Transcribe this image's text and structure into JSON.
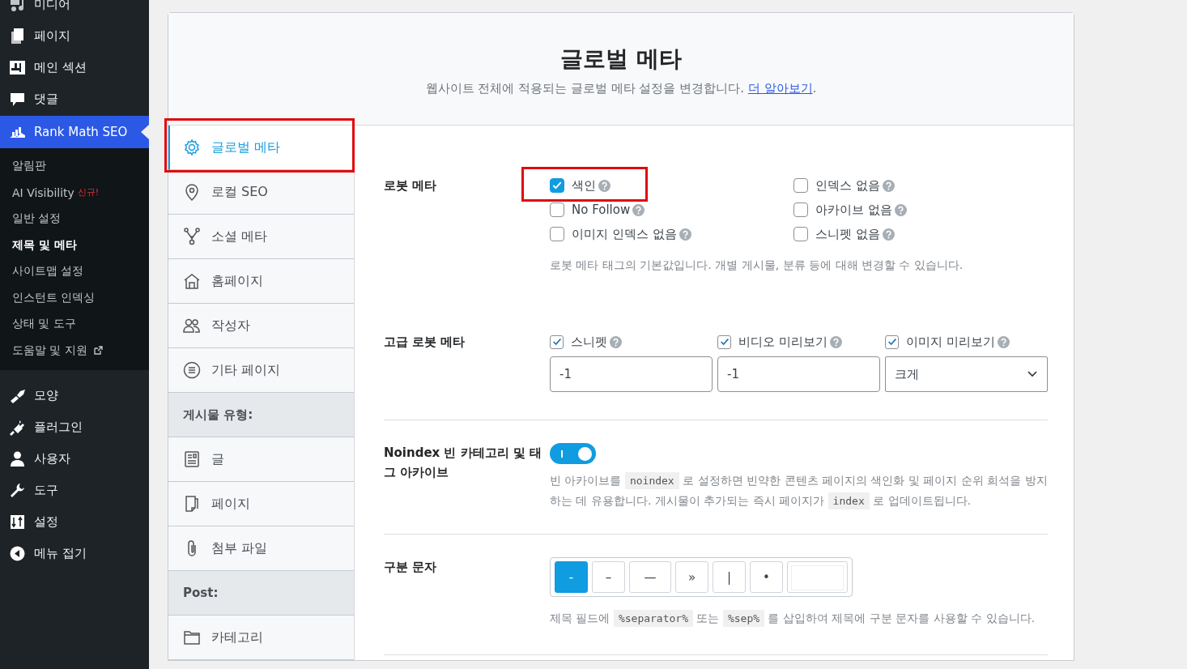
{
  "admin_menu": {
    "items_before": [
      {
        "label": "미디어",
        "selected": false
      },
      {
        "label": "페이지",
        "selected": false
      },
      {
        "label": "메인 섹션",
        "selected": false
      },
      {
        "label": "댓글",
        "selected": false
      }
    ],
    "active": {
      "label": "Rank Math SEO",
      "selected": true,
      "submenu": [
        {
          "label": "알림판",
          "selected": false
        },
        {
          "label": "AI Visibility",
          "badge": "신규!",
          "selected": false
        },
        {
          "label": "일반 설정",
          "selected": false
        },
        {
          "label": "제목 및 메타",
          "selected": true
        },
        {
          "label": "사이트맵 설정",
          "selected": false
        },
        {
          "label": "인스턴트 인덱싱",
          "selected": false
        },
        {
          "label": "상태 및 도구",
          "selected": false
        },
        {
          "label": "도움말 및 지원",
          "external": true,
          "selected": false
        }
      ]
    },
    "items_after": [
      {
        "label": "모양",
        "selected": false
      },
      {
        "label": "플러그인",
        "selected": false
      },
      {
        "label": "사용자",
        "selected": false
      },
      {
        "label": "도구",
        "selected": false
      },
      {
        "label": "설정",
        "selected": false
      },
      {
        "label": "메뉴 접기",
        "selected": false
      }
    ]
  },
  "header": {
    "title": "글로벌 메타",
    "description": "웹사이트 전체에 적용되는 글로벌 메타 설정을 변경합니다. ",
    "link": "더 알아보기",
    "description_end": "."
  },
  "nav": [
    {
      "kind": "item",
      "label": "글로벌 메타",
      "selected": true,
      "highlighted": true
    },
    {
      "kind": "item",
      "label": "로컬 SEO",
      "selected": false,
      "highlighted": false
    },
    {
      "kind": "item",
      "label": "소셜 메타",
      "selected": false,
      "highlighted": false
    },
    {
      "kind": "item",
      "label": "홈페이지",
      "selected": false,
      "highlighted": false
    },
    {
      "kind": "item",
      "label": "작성자",
      "selected": false,
      "highlighted": false
    },
    {
      "kind": "item",
      "label": "기타 페이지",
      "selected": false,
      "highlighted": false
    },
    {
      "kind": "heading",
      "label": "게시물 유형:"
    },
    {
      "kind": "item",
      "label": "글",
      "selected": false,
      "highlighted": false
    },
    {
      "kind": "item",
      "label": "페이지",
      "selected": false,
      "highlighted": false
    },
    {
      "kind": "item",
      "label": "첨부 파일",
      "selected": false,
      "highlighted": false
    },
    {
      "kind": "heading",
      "label": "Post:"
    },
    {
      "kind": "item",
      "label": "카테고리",
      "selected": false,
      "highlighted": false
    }
  ],
  "settings": [
    {
      "kind": "checkbox_grid",
      "label": "로봇 메타",
      "options": [
        {
          "label": "색인",
          "checked": true,
          "highlighted": true
        },
        {
          "label": "인덱스 없음",
          "checked": false,
          "highlighted": false
        },
        {
          "label": "No Follow",
          "checked": false,
          "highlighted": false
        },
        {
          "label": "아카이브 없음",
          "checked": false,
          "highlighted": false
        },
        {
          "label": "이미지 인덱스 없음",
          "checked": false,
          "highlighted": false
        },
        {
          "label": "스니펫 없음",
          "checked": false,
          "highlighted": false
        }
      ],
      "description": [
        {
          "text": "로봇 메타 태그의 기본값입니다. 개별 게시물, 분류 등에 대해 변경할 수 있습니다."
        }
      ]
    },
    {
      "kind": "advanced",
      "label": "고급 로봇 메타",
      "fields": [
        {
          "label": "스니펫",
          "checked": true,
          "kind": "input",
          "value": "-1"
        },
        {
          "label": "비디오 미리보기",
          "checked": true,
          "kind": "input",
          "value": "-1"
        },
        {
          "label": "이미지 미리보기",
          "checked": true,
          "kind": "select",
          "value": "크게"
        }
      ]
    },
    {
      "kind": "toggle",
      "label": "Noindex 빈 카테고리 및 태그 아카이브",
      "on": true,
      "description": [
        {
          "text": "빈 아카이브를 "
        },
        {
          "code": "noindex"
        },
        {
          "text": " 로 설정하면 빈약한 콘텐츠 페이지의 색인화 및 페이지 순위 희석을 방지하는 데 유용합니다. 게시물이 추가되는 즉시 페이지가 "
        },
        {
          "code": "index"
        },
        {
          "text": " 로 업데이트됩니다."
        }
      ]
    },
    {
      "kind": "separator",
      "label": "구분 문자",
      "options": [
        {
          "kind": "preset",
          "label": "-",
          "selected": true
        },
        {
          "kind": "preset",
          "label": "–",
          "selected": false
        },
        {
          "kind": "preset",
          "label": "—",
          "selected": false
        },
        {
          "kind": "preset",
          "label": "»",
          "selected": false
        },
        {
          "kind": "preset",
          "label": "|",
          "selected": false
        },
        {
          "kind": "preset",
          "label": "•",
          "selected": false
        },
        {
          "kind": "custom",
          "selected": false
        }
      ],
      "description": [
        {
          "text": "제목 필드에 "
        },
        {
          "code": "%separator%"
        },
        {
          "text": " 또는 "
        },
        {
          "code": "%sep%"
        },
        {
          "text": " 를 삽입하여 제목에 구분 문자를 사용할 수 있습니다."
        }
      ]
    }
  ]
}
